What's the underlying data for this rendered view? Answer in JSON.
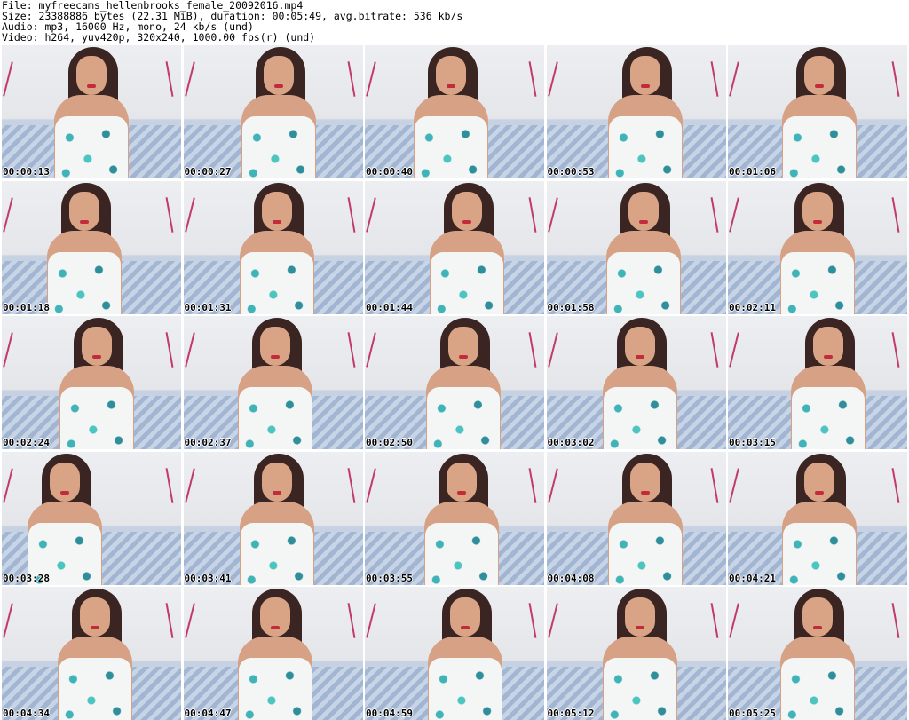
{
  "header": {
    "file": "File: myfreecams_hellenbrooks_female_20092016.mp4",
    "size": "Size: 23388886 bytes (22.31 MiB), duration: 00:05:49, avg.bitrate: 536 kb/s",
    "audio": "Audio: mp3, 16000 Hz, mono, 24 kb/s (und)",
    "video": "Video: h264, yuv420p, 320x240, 1000.00 fps(r) (und)"
  },
  "thumbnails": [
    {
      "time": "00:00:13"
    },
    {
      "time": "00:00:27"
    },
    {
      "time": "00:00:40"
    },
    {
      "time": "00:00:53"
    },
    {
      "time": "00:01:06"
    },
    {
      "time": "00:01:18"
    },
    {
      "time": "00:01:31"
    },
    {
      "time": "00:01:44"
    },
    {
      "time": "00:01:58"
    },
    {
      "time": "00:02:11"
    },
    {
      "time": "00:02:24"
    },
    {
      "time": "00:02:37"
    },
    {
      "time": "00:02:50"
    },
    {
      "time": "00:03:02"
    },
    {
      "time": "00:03:15"
    },
    {
      "time": "00:03:28"
    },
    {
      "time": "00:03:41"
    },
    {
      "time": "00:03:55"
    },
    {
      "time": "00:04:08"
    },
    {
      "time": "00:04:21"
    },
    {
      "time": "00:04:34"
    },
    {
      "time": "00:04:47"
    },
    {
      "time": "00:04:59"
    },
    {
      "time": "00:05:12"
    },
    {
      "time": "00:05:25"
    }
  ]
}
